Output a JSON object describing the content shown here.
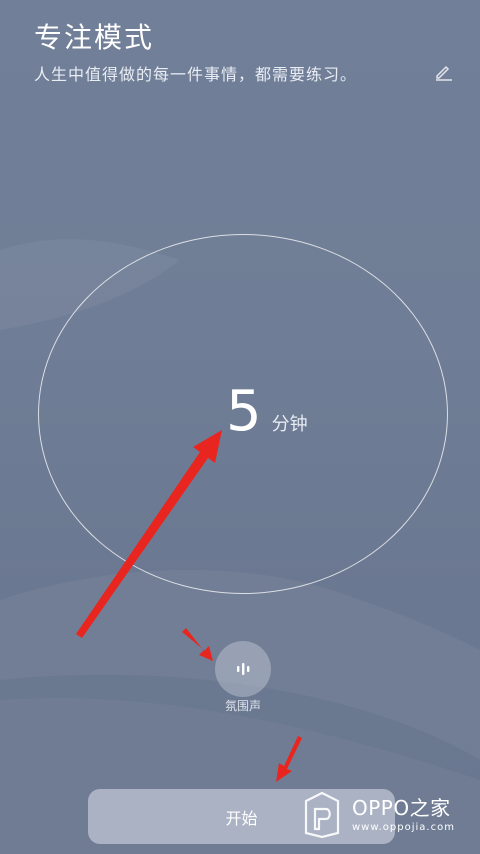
{
  "header": {
    "title": "专注模式",
    "subtitle": "人生中值得做的每一件事情，都需要练习。",
    "edit_icon": "pencil-icon"
  },
  "timer": {
    "value": "5",
    "unit": "分钟"
  },
  "ambient": {
    "icon": "sound-wave-icon",
    "label": "氛围声"
  },
  "actions": {
    "start_label": "开始"
  },
  "watermark": {
    "brand": "OPPO之家",
    "url": "www.oppojia.com"
  },
  "colors": {
    "background": "#717f98",
    "annotation_arrow": "#e8261f",
    "text": "#ffffff"
  }
}
